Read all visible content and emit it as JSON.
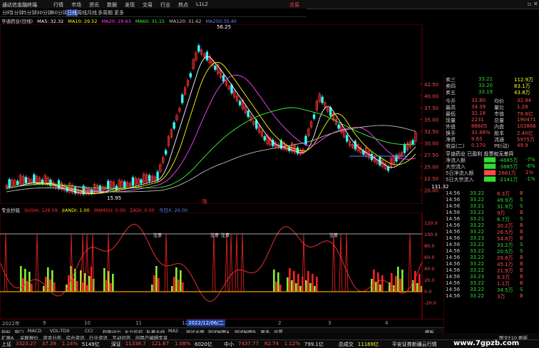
{
  "app": {
    "name": "通达信金融终端",
    "trade_label": "交易"
  },
  "menu": [
    "行情",
    "市场",
    "资讯",
    "数据",
    "发现",
    "交易",
    "行业",
    "热点",
    "L1L2"
  ],
  "periods": [
    {
      "label": "分时",
      "active": false
    },
    {
      "label": "1分钟",
      "active": false
    },
    {
      "label": "5分钟",
      "active": false
    },
    {
      "label": "30分钟",
      "active": false
    },
    {
      "label": "60分钟",
      "active": false
    },
    {
      "label": "日线",
      "active": true
    },
    {
      "label": "周线",
      "active": false
    },
    {
      "label": "月线",
      "active": false
    },
    {
      "label": "多周期",
      "active": false
    },
    {
      "label": "更多",
      "active": false
    }
  ],
  "ma_legend": {
    "title": "亨迪药业(日线)",
    "items": [
      {
        "text": "MA5: 32.32",
        "color": "#ffffff"
      },
      {
        "text": "MA10: 29.52",
        "color": "#ffff00"
      },
      {
        "text": "MA20: 29.63",
        "color": "#ff44ff"
      },
      {
        "text": "MA60: 31.15",
        "color": "#33ff33"
      },
      {
        "text": "MA120: 31.62",
        "color": "#cccccc"
      },
      {
        "text": "MA250:35.40",
        "color": "#6688ff"
      }
    ]
  },
  "price_axis": [
    "42.50",
    "40.00",
    "37.50",
    "35.00",
    "32.50",
    "30.00",
    "27.50",
    "25.00",
    "22.50",
    "20.00"
  ],
  "chart_annotations": {
    "high": "56.25",
    "low": "15.95",
    "marker": "陈"
  },
  "indicator_legend": {
    "title": "专业抄底",
    "items": [
      {
        "text": "SUSHI: 126.09",
        "color": "#ff3333"
      },
      {
        "text": "JIANDI: 1.00",
        "color": "#ffff00"
      },
      {
        "text": "MAMOU: 0.00",
        "color": "#ff3333"
      },
      {
        "text": "ZADI: 0.00",
        "color": "#ff3333"
      },
      {
        "text": "今日X: 20.00",
        "color": "#5a8cff"
      }
    ]
  },
  "indicator_axis": [
    "120.0",
    "100.0",
    "80.0",
    "60.0",
    "40.0",
    "20.0",
    "0.0",
    "-20.0"
  ],
  "indicator_marks": [
    "注意",
    "注意",
    "注意",
    "注意"
  ],
  "date_axis": {
    "left": "2022年",
    "cursor_date": "2022/12/06/二",
    "ticks": [
      "9",
      "10",
      "11",
      "12",
      "2",
      "3",
      "4"
    ]
  },
  "quote_top": [
    {
      "label": "卖三",
      "price": "33.21",
      "vol": "112.9万"
    },
    {
      "label": "卖四",
      "price": "33.20",
      "vol": "83.1万"
    },
    {
      "label": "卖五",
      "price": "33.19",
      "vol": "43.8万"
    }
  ],
  "stats": [
    {
      "l1": "今开",
      "v1": "32.80",
      "l2": "均价",
      "v2": "32.94"
    },
    {
      "l1": "最高",
      "v1": "34.39",
      "l2": "量比",
      "v2": "1.26"
    },
    {
      "l1": "最低",
      "v1": "32.18",
      "l2": "市值",
      "v2": "79.8亿"
    },
    {
      "l1": "现量",
      "v1": "2231",
      "l2": "总量",
      "v2": "190471"
    },
    {
      "l1": "外盘",
      "v1": "86605",
      "l2": "内盘",
      "v2": "103866"
    },
    {
      "l1": "换手",
      "v1": "31.88%",
      "l2": "股本",
      "v2": "2.40亿"
    },
    {
      "l1": "净资",
      "v1": "9.65",
      "l2": "流通",
      "v2": "5975万"
    },
    {
      "l1": "收益(二)",
      "v1": "0.170",
      "l2": "PE(动)",
      "v2": "49.9"
    }
  ],
  "fund_header": "亨迪药业 已盈利 投票权无差异",
  "fund_flow": [
    {
      "label": "净流入额",
      "value": "-4685万",
      "pct": "-7%",
      "color": "#33dd33"
    },
    {
      "label": "大宗流入",
      "value": "-3885万",
      "pct": "-6%",
      "color": "#33dd33"
    },
    {
      "label": "5日净流入额",
      "value": "2661万",
      "pct": "1%",
      "color": "#ff4d4d"
    },
    {
      "label": "5日大宗流入",
      "value": "-2141万",
      "pct": "-1%",
      "color": "#33dd33"
    }
  ],
  "ticks_header": "131.32",
  "ticks": [
    {
      "time": "14:56",
      "price": "33.22",
      "vol": "6.3万",
      "dir": "B"
    },
    {
      "time": "14:56",
      "price": "33.22",
      "vol": "49.9万",
      "dir": "S"
    },
    {
      "time": "14:56",
      "price": "33.21",
      "vol": "31.9万",
      "dir": "S"
    },
    {
      "time": "14:56",
      "price": "33.22",
      "vol": "9万",
      "dir": "B"
    },
    {
      "time": "14:56",
      "price": "33.21",
      "vol": "6.7万",
      "dir": "S"
    },
    {
      "time": "14:56",
      "price": "33.22",
      "vol": "30.2万",
      "dir": "B"
    },
    {
      "time": "14:56",
      "price": "33.22",
      "vol": "26.5万",
      "dir": "B"
    },
    {
      "time": "14:56",
      "price": "33.23",
      "vol": "54.8万",
      "dir": "B"
    },
    {
      "time": "14:56",
      "price": "33.22",
      "vol": "33.2万",
      "dir": "S"
    },
    {
      "time": "14:56",
      "price": "33.22",
      "vol": "20.5万",
      "dir": "S"
    },
    {
      "time": "14:56",
      "price": "33.22",
      "vol": "29.6万",
      "dir": "B"
    },
    {
      "time": "14:56",
      "price": "33.22",
      "vol": "45.1万",
      "dir": "B"
    },
    {
      "time": "14:56",
      "price": "33.22",
      "vol": "21.9万",
      "dir": "B"
    },
    {
      "time": "14:56",
      "price": "33.23",
      "vol": "8.3万",
      "dir": "B"
    },
    {
      "time": "14:56",
      "price": "33.22",
      "vol": "1.1万",
      "dir": "B"
    },
    {
      "time": "14:56",
      "price": "33.22",
      "vol": "34.5万",
      "dir": "S"
    },
    {
      "time": "14:56",
      "price": "33.22",
      "vol": "3万",
      "dir": "B"
    }
  ],
  "bottom_tabs": [
    {
      "label": "指标",
      "active": false
    },
    {
      "label": "窗口",
      "active": false
    },
    {
      "label": "MACD",
      "active": false
    },
    {
      "label": "VOL-TDX",
      "active": false
    },
    {
      "label": "CCI",
      "active": false
    },
    {
      "label": "趋势动力",
      "active": false
    },
    {
      "label": "主力监控",
      "active": false
    },
    {
      "label": "私募主线",
      "active": false
    },
    {
      "label": "MA2",
      "active": false
    },
    {
      "label": "测试主图",
      "active": false
    },
    {
      "label": "测试幅图A",
      "active": false
    },
    {
      "label": "测试幅图B",
      "active": false
    },
    {
      "label": "更多",
      "active": false
    },
    {
      "label": "设置",
      "active": false
    }
  ],
  "bottom_tabs_right": "模板",
  "tabs2": [
    "扩展A",
    "关联报价",
    "资金分布",
    "综合资讯",
    "行业资讯",
    "互动问答",
    "创用户编辑专享"
  ],
  "tabs2_right": "图文F10 刷新",
  "status": [
    {
      "text": "上证",
      "color": "#e6e6e6"
    },
    {
      "text": "3323.27",
      "color": "#ff4d4d"
    },
    {
      "text": "37.39",
      "color": "#ff4d4d"
    },
    {
      "text": "1.14%",
      "color": "#ff4d4d"
    },
    {
      "text": "5149亿",
      "color": "#e6e6e6"
    },
    {
      "text": "深证",
      "color": "#e6e6e6"
    },
    {
      "text": "11338.7",
      "color": "#ff4d4d"
    },
    {
      "text": "121.67",
      "color": "#ff4d4d"
    },
    {
      "text": "1.08%",
      "color": "#ff4d4d"
    },
    {
      "text": "6020亿",
      "color": "#e6e6e6"
    },
    {
      "text": "中小",
      "color": "#e6e6e6"
    },
    {
      "text": "7437.77",
      "color": "#ff4d4d"
    },
    {
      "text": "82.74",
      "color": "#ff4d4d"
    },
    {
      "text": "1.12%",
      "color": "#ff4d4d"
    },
    {
      "text": "799.1亿",
      "color": "#e6e6e6"
    },
    {
      "text": "总成交",
      "color": "#e6e6e6"
    },
    {
      "text": "11169亿",
      "color": "#ffff33"
    },
    {
      "text": "平安证券新疆云行情",
      "color": "#e6e6e6"
    }
  ],
  "watermark": "www.7gpzb.com"
}
